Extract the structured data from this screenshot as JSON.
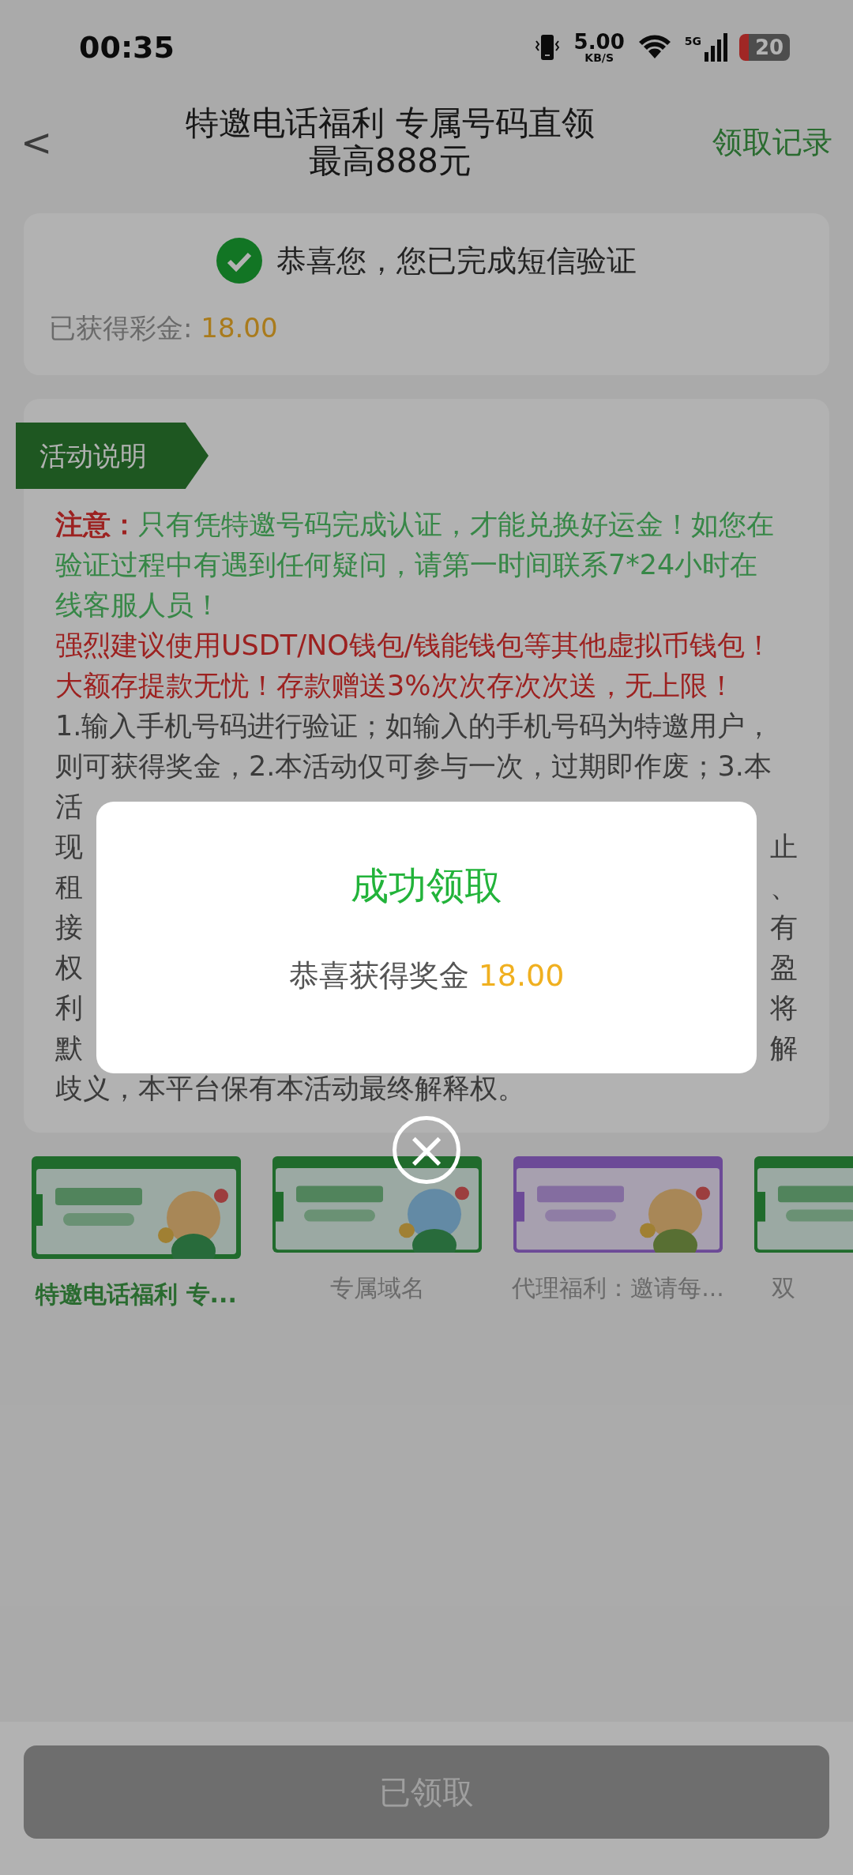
{
  "status_bar": {
    "time": "00:35",
    "speed_value": "5.00",
    "speed_unit": "KB/S",
    "network": "5G",
    "battery": "20"
  },
  "header": {
    "back": "<",
    "title_lines": [
      "特邀电话福利 专属号码直领",
      "最高888元"
    ],
    "action": "领取记录"
  },
  "verify_card": {
    "message": "恭喜您，您已完成短信验证",
    "bonus_label": "已获得彩金:",
    "bonus_value": "18.00"
  },
  "rules_card": {
    "tag": "活动说明",
    "lines_top": [
      {
        "segments": [
          {
            "kind": "label",
            "text": "注意："
          },
          {
            "kind": "green",
            "text": "只有凭特邀号码完成认证，才能兑换好运金！如您在"
          }
        ]
      },
      {
        "segments": [
          {
            "kind": "green",
            "text": "验证过程中有遇到任何疑问，请第一时间联系7*24小时在"
          }
        ]
      },
      {
        "segments": [
          {
            "kind": "green",
            "text": "线客服人员！"
          }
        ]
      },
      {
        "segments": [
          {
            "kind": "red",
            "text": "强烈建议使用USDT/NO钱包/钱能钱包等其他虚拟币钱包！"
          }
        ]
      },
      {
        "segments": [
          {
            "kind": "red",
            "text": "大额存提款无忧！存款赠送3%次次存次次送，无上限！"
          }
        ]
      },
      {
        "segments": [
          {
            "kind": "plain",
            "text": "1.输入手机号码进行验证；如输入的手机号码为特邀用户，"
          }
        ]
      },
      {
        "segments": [
          {
            "kind": "plain",
            "text": "则可获得奖金，2.本活动仅可参与一次，过期即作废；3.本"
          }
        ]
      }
    ],
    "lines_covered": [
      {
        "left": "活"
      },
      {
        "left": "现",
        "right": "止"
      },
      {
        "left": "租",
        "right": "、"
      },
      {
        "left": "接",
        "right": "有"
      },
      {
        "left": "权",
        "right": "盈"
      },
      {
        "left": "利",
        "right": "将"
      },
      {
        "left": "默",
        "right": "解"
      }
    ],
    "line_last": "歧义，本平台保有本活动最终解释权。"
  },
  "banners": [
    {
      "caption": "特邀电话福利 专...",
      "selected": true
    },
    {
      "caption": "专属域名",
      "selected": false
    },
    {
      "caption": "代理福利：邀请每...",
      "selected": false
    },
    {
      "caption": "双",
      "selected": false
    }
  ],
  "bottom_button": {
    "label": "已领取",
    "disabled": true
  },
  "dialog": {
    "title": "成功领取",
    "message": "恭喜获得奖金",
    "amount": "18.00",
    "close": "×"
  }
}
